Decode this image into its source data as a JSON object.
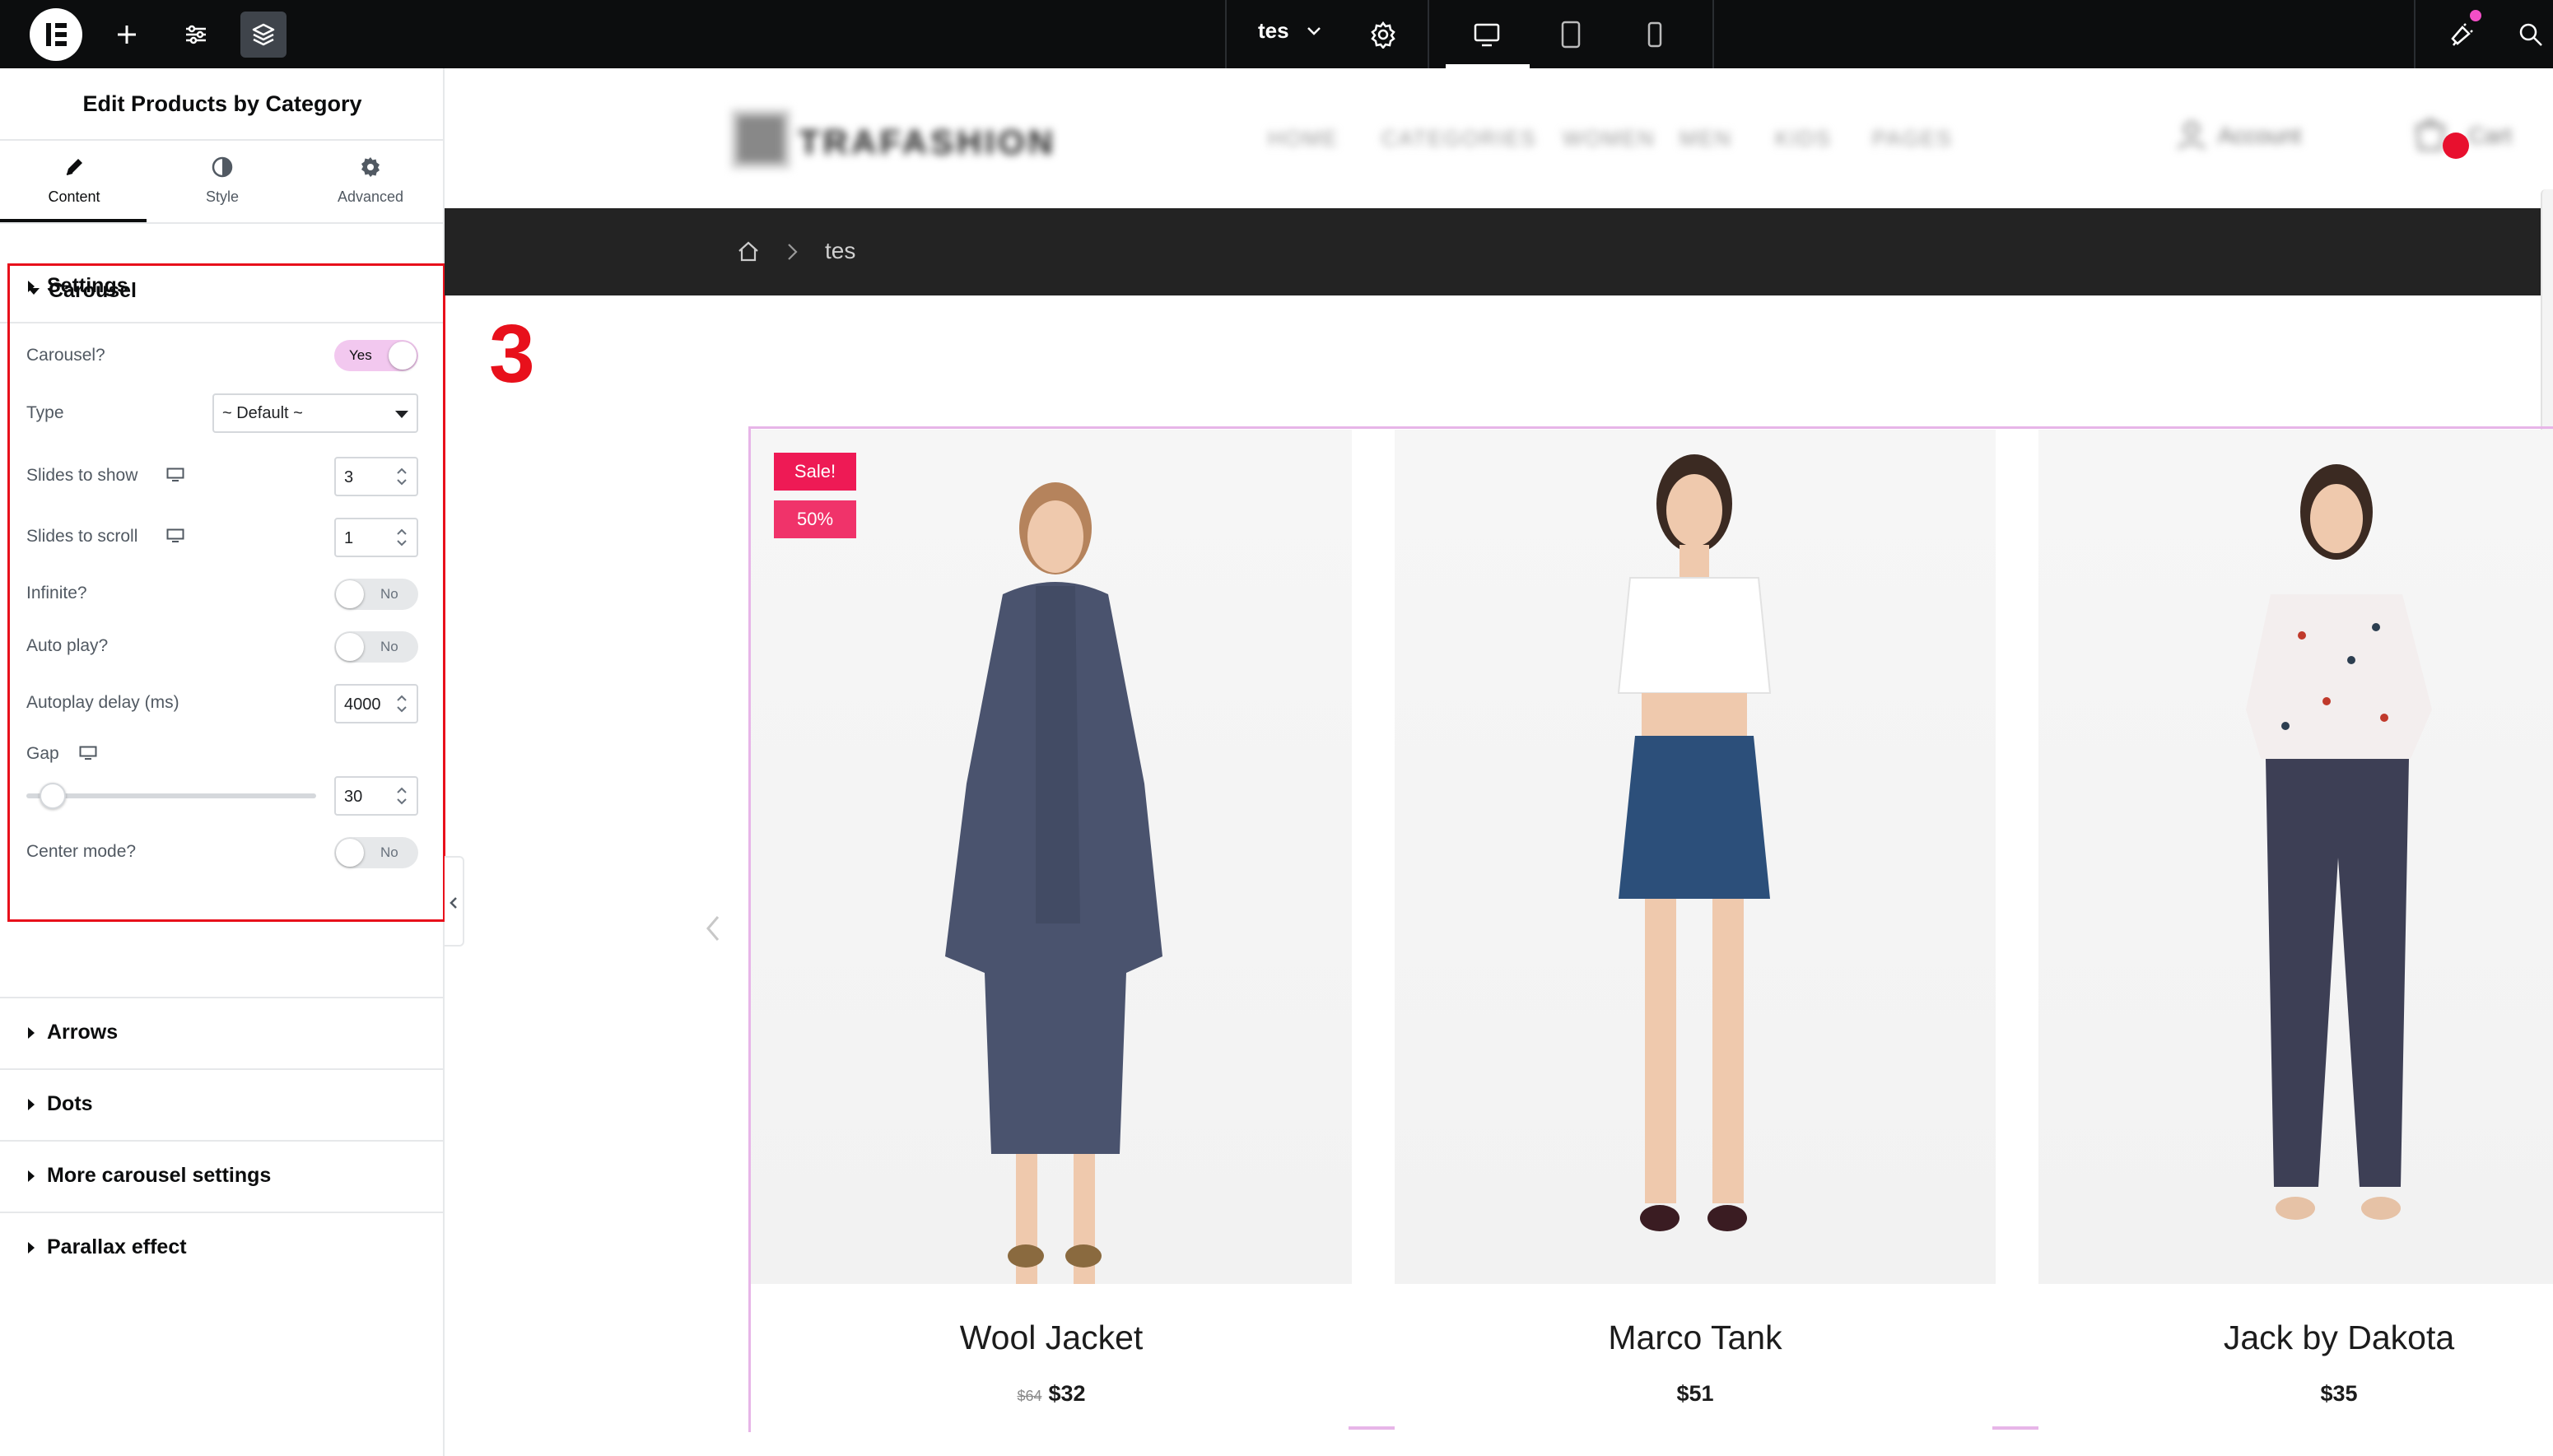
{
  "topbar": {
    "document_name": "tes",
    "icons": [
      "elementor-logo-icon",
      "add-icon",
      "settings-sliders-icon",
      "layers-icon",
      "chevron-down-icon",
      "gear-icon",
      "desktop-icon",
      "tablet-icon",
      "mobile-icon",
      "notification-icon",
      "search-icon"
    ]
  },
  "panel": {
    "title": "Edit Products by Category",
    "tabs": [
      {
        "label": "Content",
        "icon": "pencil-icon",
        "active": true
      },
      {
        "label": "Style",
        "icon": "contrast-icon",
        "active": false
      },
      {
        "label": "Advanced",
        "icon": "gear-icon",
        "active": false
      }
    ],
    "sections": {
      "settings": "Settings",
      "carousel": "Carousel",
      "arrows": "Arrows",
      "dots": "Dots",
      "more": "More carousel settings",
      "parallax": "Parallax effect"
    },
    "carousel": {
      "carousel_label": "Carousel?",
      "carousel_value": "Yes",
      "type_label": "Type",
      "type_value": "~ Default ~",
      "slides_show_label": "Slides to show",
      "slides_show_value": "3",
      "slides_scroll_label": "Slides to scroll",
      "slides_scroll_value": "1",
      "infinite_label": "Infinite?",
      "infinite_value": "No",
      "autoplay_label": "Auto play?",
      "autoplay_value": "No",
      "autoplay_delay_label": "Autoplay delay (ms)",
      "autoplay_delay_value": "4000",
      "gap_label": "Gap",
      "gap_value": "30",
      "center_label": "Center mode?",
      "center_value": "No"
    }
  },
  "site": {
    "logo_text": "TRAFASHION",
    "nav": [
      "HOME",
      "CATEGORIES",
      "WOMEN",
      "MEN",
      "KIDS",
      "PAGES"
    ],
    "account": "Account",
    "cart": "Cart",
    "breadcrumb_current": "tes"
  },
  "annotation": {
    "step": "3"
  },
  "products": [
    {
      "name": "Wool Jacket",
      "old_price": "$64",
      "price": "$32",
      "sale_badge": "Sale!",
      "discount_badge": "50%"
    },
    {
      "name": "Marco Tank",
      "price": "$51"
    },
    {
      "name": "Jack by Dakota",
      "price": "$35"
    }
  ],
  "colors": {
    "accent_pink": "#e7b5e8",
    "toggle_on": "#f2c8ef",
    "annotation_red": "#e8101b",
    "sale_badge": "#ee1a55"
  }
}
